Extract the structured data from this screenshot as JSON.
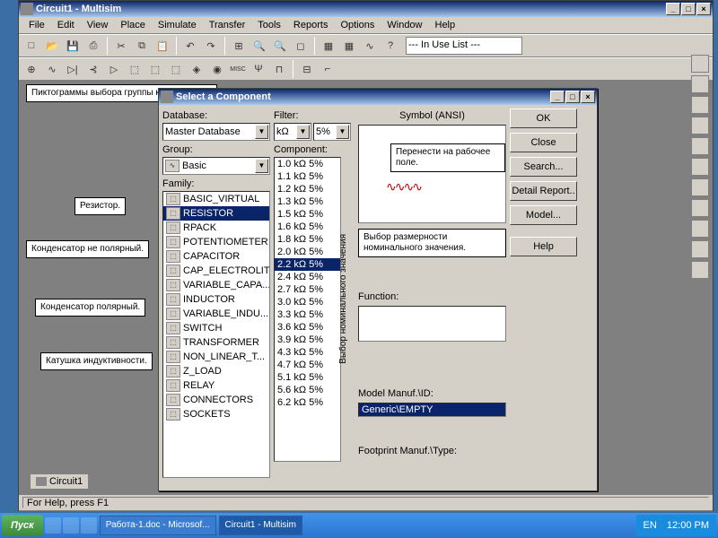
{
  "app": {
    "title": "Circuit1 - Multisim",
    "statusbar": "For Help, press F1",
    "circuit_tab": "Circuit1"
  },
  "menus": [
    "File",
    "Edit",
    "View",
    "Place",
    "Simulate",
    "Transfer",
    "Tools",
    "Reports",
    "Options",
    "Window",
    "Help"
  ],
  "inuse": "--- In Use List ---",
  "dialog": {
    "title": "Select a Component",
    "labels": {
      "database": "Database:",
      "group": "Group:",
      "family": "Family:",
      "filter": "Filter:",
      "component": "Component:",
      "symbol": "Symbol (ANSI)",
      "function": "Function:",
      "model": "Model Manuf.\\ID:",
      "footprint": "Footprint Manuf.\\Type:"
    },
    "database_val": "Master Database",
    "group_val": "Basic",
    "filter1": "kΩ",
    "filter2": "5%",
    "families": [
      "BASIC_VIRTUAL",
      "RESISTOR",
      "RPACK",
      "POTENTIOMETER",
      "CAPACITOR",
      "CAP_ELECTROLIT",
      "VARIABLE_CAPA...",
      "INDUCTOR",
      "VARIABLE_INDU...",
      "SWITCH",
      "TRANSFORMER",
      "NON_LINEAR_T...",
      "Z_LOAD",
      "RELAY",
      "CONNECTORS",
      "SOCKETS"
    ],
    "components": [
      "1.0 kΩ 5%",
      "1.1 kΩ 5%",
      "1.2 kΩ 5%",
      "1.3 kΩ 5%",
      "1.5 kΩ 5%",
      "1.6 kΩ 5%",
      "1.8 kΩ 5%",
      "2.0 kΩ 5%",
      "2.2 kΩ 5%",
      "2.4 kΩ 5%",
      "2.7 kΩ 5%",
      "3.0 kΩ 5%",
      "3.3 kΩ 5%",
      "3.6 kΩ 5%",
      "3.9 kΩ 5%",
      "4.3 kΩ 5%",
      "4.7 kΩ 5%",
      "5.1 kΩ 5%",
      "5.6 kΩ 5%",
      "6.2 kΩ 5%"
    ],
    "selected_component": 8,
    "model_val": "Generic\\EMPTY",
    "buttons": {
      "ok": "OK",
      "close": "Close",
      "search": "Search...",
      "detail": "Detail Report..",
      "model": "Model...",
      "help": "Help"
    },
    "vtext": "Выбор номинального значения"
  },
  "notes": {
    "pictograms": "Пиктограммы выбора\nгруппы компонентов.",
    "resistor": "Резистор.",
    "cap_np": "Конденсатор\nне полярный.",
    "cap_p": "Конденсатор\nполярный.",
    "inductor": "Катушка\nиндуктивности.",
    "transfer": "Перенести\nна рабочее поле.",
    "dimension": "Выбор размерности\nноминального значения."
  },
  "taskbar": {
    "start": "Пуск",
    "tasks": [
      "Работа-1.doc - Microsof...",
      "Circuit1 - Multisim"
    ],
    "lang": "EN",
    "time": "12:00 PM"
  }
}
